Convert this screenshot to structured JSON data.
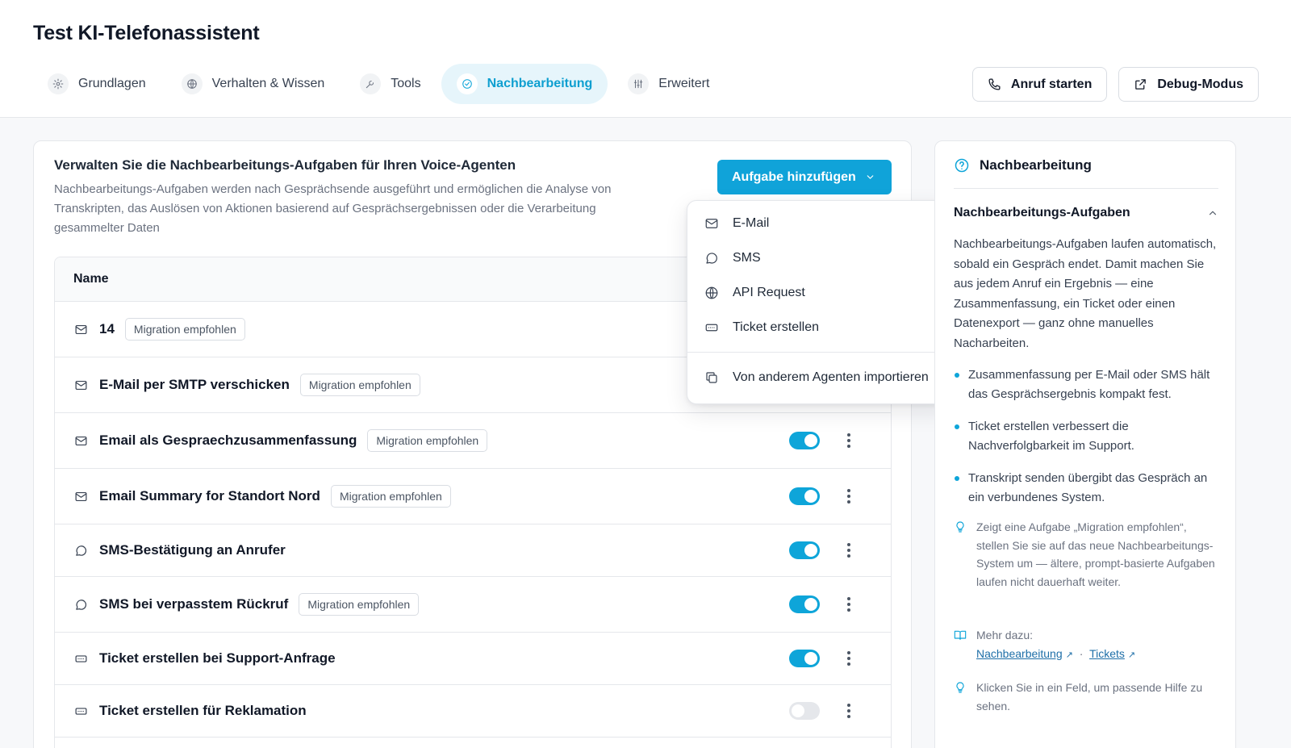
{
  "header": {
    "title": "Test KI-Telefonassistent",
    "tabs": [
      {
        "label": "Grundlagen",
        "icon": "gear-icon",
        "active": false
      },
      {
        "label": "Verhalten & Wissen",
        "icon": "globe-icon",
        "active": false
      },
      {
        "label": "Tools",
        "icon": "wrench-icon",
        "active": false
      },
      {
        "label": "Nachbearbeitung",
        "icon": "check-circle-icon",
        "active": true
      },
      {
        "label": "Erweitert",
        "icon": "sliders-icon",
        "active": false
      }
    ],
    "actions": {
      "call_label": "Anruf starten",
      "debug_label": "Debug-Modus"
    }
  },
  "main": {
    "heading": "Verwalten Sie die Nachbearbeitungs-Aufgaben für Ihren Voice-Agenten",
    "description": "Nachbearbeitungs-Aufgaben werden nach Gesprächsende ausgeführt und ermöglichen die Analyse von Transkripten, das Auslösen von Aktionen basierend auf Gesprächsergebnissen oder die Verarbeitung gesammelter Daten",
    "add_button_label": "Aufgabe hinzufügen",
    "table": {
      "column_name": "Name",
      "rows": [
        {
          "type": "email",
          "name": "14",
          "badge": "Migration empfohlen",
          "enabled": null
        },
        {
          "type": "email",
          "name": "E-Mail per SMTP verschicken",
          "badge": "Migration empfohlen",
          "enabled": null
        },
        {
          "type": "email",
          "name": "Email als Gespraechzusammenfassung",
          "badge": "Migration empfohlen",
          "enabled": true
        },
        {
          "type": "email",
          "name": "Email Summary for Standort Nord",
          "badge": "Migration empfohlen",
          "enabled": true
        },
        {
          "type": "sms",
          "name": "SMS-Bestätigung an Anrufer",
          "badge": "",
          "enabled": true
        },
        {
          "type": "sms",
          "name": "SMS bei verpasstem Rückruf",
          "badge": "Migration empfohlen",
          "enabled": true
        },
        {
          "type": "ticket",
          "name": "Ticket erstellen bei Support-Anfrage",
          "badge": "",
          "enabled": true
        },
        {
          "type": "ticket",
          "name": "Ticket erstellen für Reklamation",
          "badge": "",
          "enabled": false
        }
      ]
    }
  },
  "dropdown": {
    "items": [
      {
        "label": "E-Mail",
        "icon": "mail-icon"
      },
      {
        "label": "SMS",
        "icon": "chat-bubble-icon"
      },
      {
        "label": "API Request",
        "icon": "globe-icon"
      },
      {
        "label": "Ticket erstellen",
        "icon": "ticket-icon"
      }
    ],
    "import_label": "Von anderem Agenten importieren"
  },
  "help": {
    "title": "Nachbearbeitung",
    "section_title": "Nachbearbeitungs-Aufgaben",
    "paragraph": "Nachbearbeitungs-Aufgaben laufen automatisch, sobald ein Gespräch endet. Damit machen Sie aus jedem Anruf ein Ergebnis — eine Zusammenfassung, ein Ticket oder einen Datenexport — ganz ohne manuelles Nacharbeiten.",
    "bullets": [
      "Zusammenfassung per E-Mail oder SMS hält das Gesprächsergebnis kompakt fest.",
      "Ticket erstellen verbessert die Nachverfolgbarkeit im Support.",
      "Transkript senden übergibt das Gespräch an ein verbundenes System."
    ],
    "tip_migration": "Zeigt eine Aufgabe „Migration empfohlen“, stellen Sie sie auf das neue Nachbearbeitungs-System um — ältere, prompt-basierte Aufgaben laufen nicht dauerhaft weiter.",
    "more_label": "Mehr dazu:",
    "link_1": "Nachbearbeitung",
    "link_separator": "·",
    "link_2": "Tickets",
    "tip_click": "Klicken Sie in ein Feld, um passende Hilfe zu sehen."
  },
  "colors": {
    "accent": "#0ea5d9",
    "button_primary": "#10a3d9",
    "active_tab_bg": "#e6f5fb",
    "link": "#1e6fa8"
  }
}
